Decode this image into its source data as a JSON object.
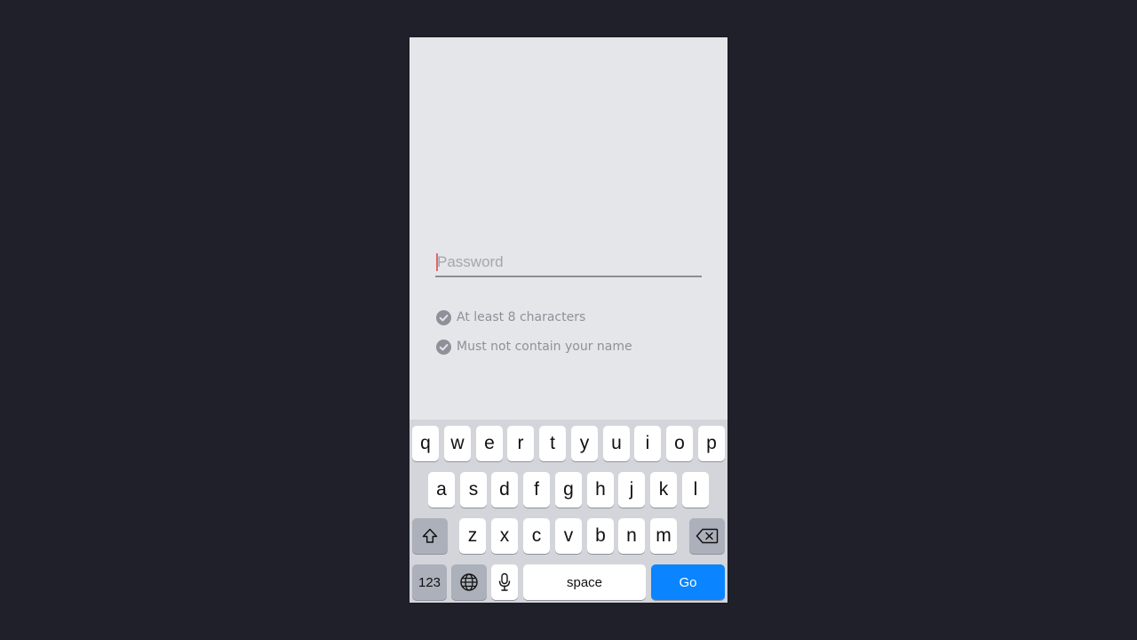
{
  "password": {
    "value": "",
    "placeholder": "Password"
  },
  "rules": [
    {
      "text": "At least 8 characters",
      "icon": "check-circle-icon"
    },
    {
      "text": "Must not contain your name",
      "icon": "check-circle-icon"
    }
  ],
  "keyboard": {
    "row1": [
      "q",
      "w",
      "e",
      "r",
      "t",
      "y",
      "u",
      "i",
      "o",
      "p"
    ],
    "row2": [
      "a",
      "s",
      "d",
      "f",
      "g",
      "h",
      "j",
      "k",
      "l"
    ],
    "row3": [
      "z",
      "x",
      "c",
      "v",
      "b",
      "n",
      "m"
    ],
    "numbers_label": "123",
    "space_label": "space",
    "go_label": "Go"
  },
  "colors": {
    "accent": "#0a84ff",
    "caret": "#e0666b",
    "rule_icon": "#8e9199",
    "background": "#1f2029"
  }
}
